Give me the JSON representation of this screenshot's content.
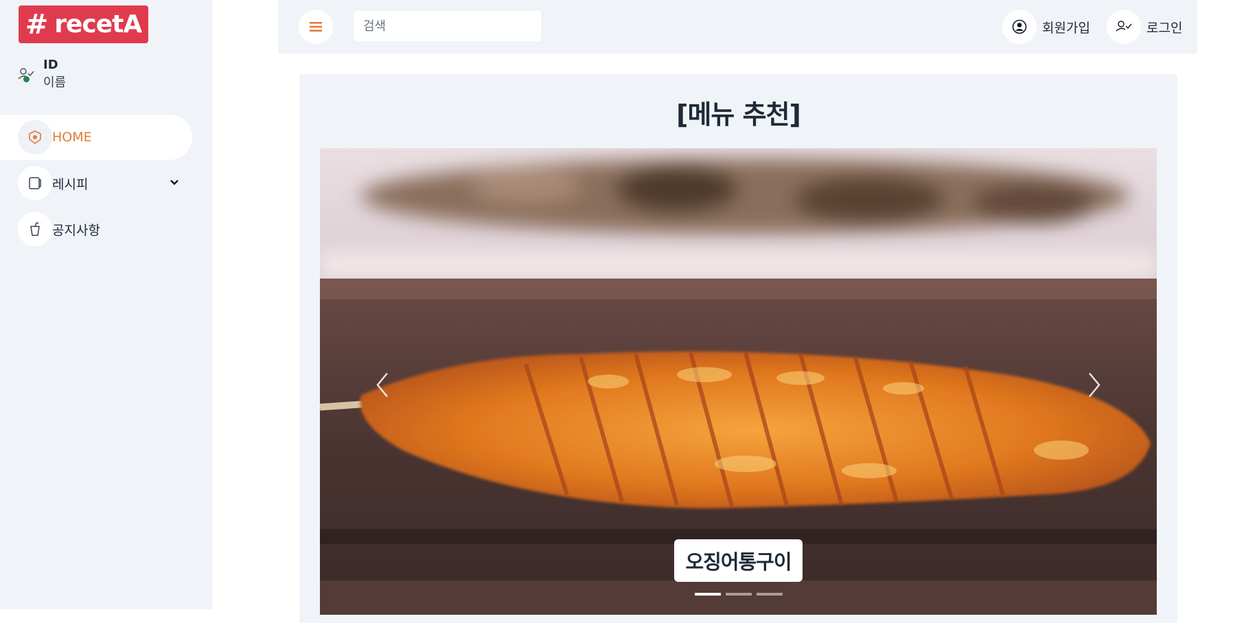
{
  "brand": {
    "logo_hash": "#",
    "logo_text": "recetA",
    "color": "#e03a4e"
  },
  "user": {
    "id": "ID",
    "name": "이름",
    "status_color": "#1e8a4c"
  },
  "sidebar": {
    "items": [
      {
        "label": "HOME",
        "icon": "home-icon",
        "active": true
      },
      {
        "label": "레시피",
        "icon": "recipe-icon",
        "expandable": true
      },
      {
        "label": "공지사항",
        "icon": "cup-icon"
      }
    ]
  },
  "topbar": {
    "search_placeholder": "검색",
    "signup_label": "회원가입",
    "login_label": "로그인"
  },
  "main": {
    "title": "[메뉴 추천]",
    "carousel": {
      "caption": "오징어통구이",
      "slide_count": 3,
      "active_slide": 1
    }
  },
  "colors": {
    "accent": "#e07b39",
    "panel": "#f0f4f8"
  }
}
